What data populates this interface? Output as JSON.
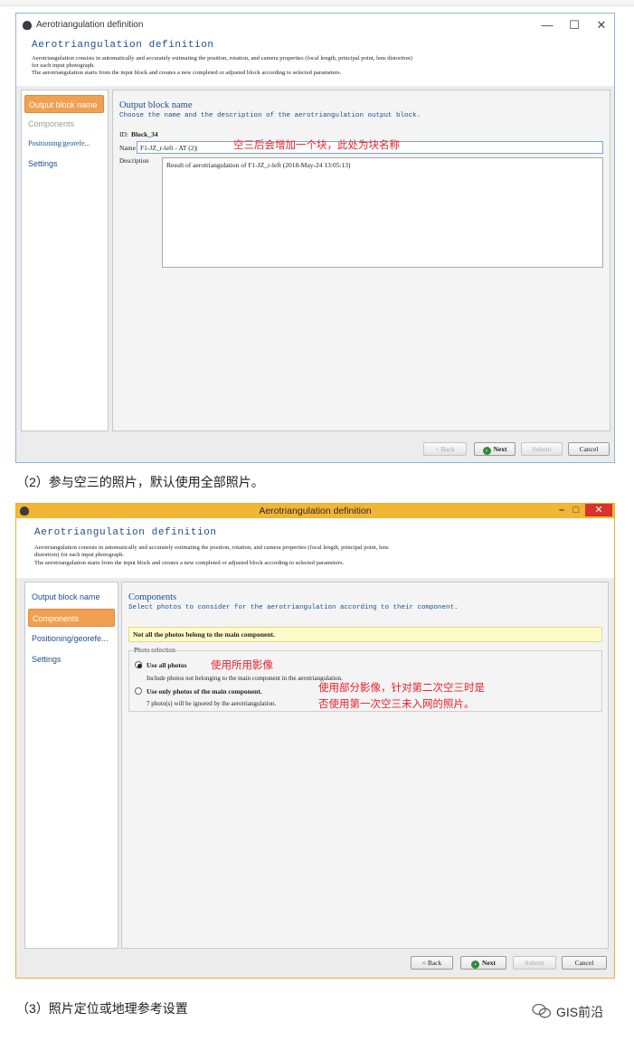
{
  "window1": {
    "title": "Aerotriangulation definition",
    "controls": {
      "minimize": "—",
      "maximize": "☐",
      "close": "✕"
    },
    "header_title": "Aerotriangulation definition",
    "header_desc_1": "Aerotriangulation consists in automatically and accurately estimating the position, rotation, and camera properties (focal length, principal point, lens distortion)",
    "header_desc_2": "for each input photograph.",
    "header_desc_3": "The aerotriangulation starts from the input block and creates a new completed or adjusted block according to selected parameters.",
    "sidebar": [
      {
        "label": "Output block name"
      },
      {
        "label": "Components"
      },
      {
        "label": "Positioning/georefe..."
      },
      {
        "label": "Settings"
      }
    ],
    "content_title": "Output block name",
    "content_subtitle": "Choose the name and the description of the aerotriangulation output block.",
    "id_label": "ID:",
    "id_value": "Block_34",
    "name_label": "Name",
    "name_value": "F1-JZ_r-left - AT (2)|",
    "annotation": "空三后会增加一个块，此处为块名称",
    "description_label": "Description",
    "description_value": "Result of aerotriangulation of F1-JZ_r-left (2018-May-24 13:05:13)",
    "buttons": {
      "back": "< Back",
      "next": "Next",
      "submit": "Submit",
      "cancel": "Cancel"
    }
  },
  "caption2": "（2）参与空三的照片，默认使用全部照片。",
  "window2": {
    "title": "Aerotriangulation definition",
    "controls": {
      "minimize": "–",
      "maximize": "□",
      "close": "✕"
    },
    "header_title": "Aerotriangulation definition",
    "header_desc_1": "Aerotriangulation consists in automatically and accurately estimating the position, rotation, and camera properties (focal length, principal point, lens",
    "header_desc_2": "distortion) for each input photograph.",
    "header_desc_3": "The aerotriangulation starts from the input block and creates a new completed or adjusted block according to selected parameters.",
    "sidebar": [
      {
        "label": "Output block name"
      },
      {
        "label": "Components"
      },
      {
        "label": "Positioning/georefe..."
      },
      {
        "label": "Settings"
      }
    ],
    "content_title": "Components",
    "content_subtitle": "Select photos to consider for the aerotriangulation according to their component.",
    "warning": "Not all the photos belong to the main component.",
    "group_title": "Photo selection",
    "option1_label": "Use all photos",
    "option1_annotation": "使用所用影像",
    "option1_desc": "Include photos not belonging to the main component in the aerotriangulation.",
    "option2_label": "Use only photos of the main component.",
    "option2_desc": "7 photo(s) will be ignored by the aerotriangulation.",
    "option2_annotation_1": "使用部分影像，针对第二次空三时是",
    "option2_annotation_2": "否使用第一次空三未入网的照片。",
    "buttons": {
      "back": "< Back",
      "next": "Next",
      "submit": "Submit",
      "cancel": "Cancel"
    }
  },
  "caption3": "（3）照片定位或地理参考设置",
  "watermark": "GIS前沿"
}
